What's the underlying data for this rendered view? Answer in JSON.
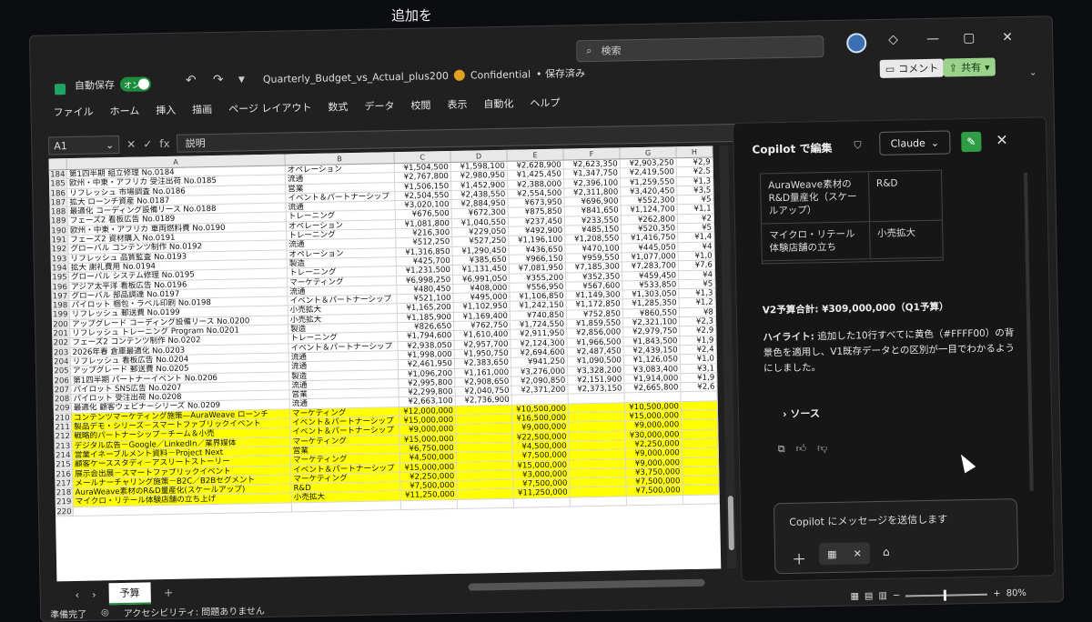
{
  "caption": "追加を",
  "app": {
    "autosave_label": "自動保存",
    "toggle": "オン",
    "filename": "Quarterly_Budget_vs_Actual_plus200",
    "sensitivity": "Confidential",
    "saved": "• 保存済み",
    "search_placeholder": "検索",
    "comment_btn": "コメント",
    "share_btn": "共有"
  },
  "ribbon": [
    "ファイル",
    "ホーム",
    "挿入",
    "描画",
    "ページ レイアウト",
    "数式",
    "データ",
    "校閲",
    "表示",
    "自動化",
    "ヘルプ"
  ],
  "formula": {
    "namebox": "A1",
    "value": "説明"
  },
  "columns": [
    "A",
    "B",
    "C",
    "D",
    "E",
    "F",
    "G",
    "H"
  ],
  "rows": [
    {
      "n": "184",
      "a": "第1四半期 組立修理 No.0184",
      "b": "オペレーション",
      "c": "¥1,504,500",
      "d": "¥1,598,100",
      "e": "¥2,628,900",
      "f": "¥2,623,350",
      "g": "¥2,903,250",
      "h": "¥2,9",
      "hl": false
    },
    {
      "n": "185",
      "a": "欧州・中東・アフリカ 受注出荷 No.0185",
      "b": "流通",
      "c": "¥2,767,800",
      "d": "¥2,980,950",
      "e": "¥1,425,450",
      "f": "¥1,347,750",
      "g": "¥2,419,500",
      "h": "¥2,5",
      "hl": false
    },
    {
      "n": "186",
      "a": "リフレッシュ 市場調査 No.0186",
      "b": "営業",
      "c": "¥1,506,150",
      "d": "¥1,452,900",
      "e": "¥2,388,000",
      "f": "¥2,396,100",
      "g": "¥1,259,550",
      "h": "¥1,3",
      "hl": false
    },
    {
      "n": "187",
      "a": "拡大 ローンチ資産 No.0187",
      "b": "イベント＆パートナーシップ",
      "c": "¥2,504,550",
      "d": "¥2,438,550",
      "e": "¥2,554,500",
      "f": "¥2,311,800",
      "g": "¥3,420,450",
      "h": "¥3,5",
      "hl": false
    },
    {
      "n": "188",
      "a": "最適化 コーディング設備リース No.0188",
      "b": "流通",
      "c": "¥3,020,100",
      "d": "¥2,884,950",
      "e": "¥673,950",
      "f": "¥696,900",
      "g": "¥552,300",
      "h": "¥5",
      "hl": false
    },
    {
      "n": "189",
      "a": "フェーズ2 看板広告 No.0189",
      "b": "トレーニング",
      "c": "¥676,500",
      "d": "¥672,300",
      "e": "¥875,850",
      "f": "¥841,650",
      "g": "¥1,124,700",
      "h": "¥1,1",
      "hl": false
    },
    {
      "n": "190",
      "a": "欧州・中東・アフリカ 車両燃料費 No.0190",
      "b": "オペレーション",
      "c": "¥1,081,800",
      "d": "¥1,040,550",
      "e": "¥237,450",
      "f": "¥233,550",
      "g": "¥262,800",
      "h": "¥2",
      "hl": false
    },
    {
      "n": "191",
      "a": "フェーズ2 資材購入 No.0191",
      "b": "トレーニング",
      "c": "¥216,300",
      "d": "¥229,050",
      "e": "¥492,900",
      "f": "¥485,150",
      "g": "¥520,350",
      "h": "¥5",
      "hl": false
    },
    {
      "n": "192",
      "a": "グローバル コンテンツ制作 No.0192",
      "b": "流通",
      "c": "¥512,250",
      "d": "¥527,250",
      "e": "¥1,196,100",
      "f": "¥1,208,550",
      "g": "¥1,416,750",
      "h": "¥1,4",
      "hl": false
    },
    {
      "n": "193",
      "a": "リフレッシュ 品質監査 No.0193",
      "b": "オペレーション",
      "c": "¥1,316,850",
      "d": "¥1,290,450",
      "e": "¥436,650",
      "f": "¥470,100",
      "g": "¥445,050",
      "h": "¥4",
      "hl": false
    },
    {
      "n": "194",
      "a": "拡大 謝礼費用 No.0194",
      "b": "製造",
      "c": "¥425,700",
      "d": "¥385,650",
      "e": "¥966,150",
      "f": "¥959,550",
      "g": "¥1,077,000",
      "h": "¥1,0",
      "hl": false
    },
    {
      "n": "195",
      "a": "グローバル システム修理 No.0195",
      "b": "トレーニング",
      "c": "¥1,231,500",
      "d": "¥1,131,450",
      "e": "¥7,081,950",
      "f": "¥7,185,300",
      "g": "¥7,283,700",
      "h": "¥7,6",
      "hl": false
    },
    {
      "n": "196",
      "a": "アジア太平洋 看板広告 No.0196",
      "b": "マーケティング",
      "c": "¥6,998,250",
      "d": "¥6,991,050",
      "e": "¥355,200",
      "f": "¥352,350",
      "g": "¥459,450",
      "h": "¥4",
      "hl": false
    },
    {
      "n": "197",
      "a": "グローバル 部品調達 No.0197",
      "b": "流通",
      "c": "¥480,450",
      "d": "¥408,000",
      "e": "¥556,950",
      "f": "¥567,600",
      "g": "¥533,850",
      "h": "¥5",
      "hl": false
    },
    {
      "n": "198",
      "a": "パイロット 梱包・ラベル印刷 No.0198",
      "b": "イベント＆パートナーシップ",
      "c": "¥521,100",
      "d": "¥495,000",
      "e": "¥1,106,850",
      "f": "¥1,149,300",
      "g": "¥1,303,050",
      "h": "¥1,3",
      "hl": false
    },
    {
      "n": "199",
      "a": "リフレッシュ 郵送費 No.0199",
      "b": "小売拡大",
      "c": "¥1,165,200",
      "d": "¥1,102,950",
      "e": "¥1,242,150",
      "f": "¥1,172,850",
      "g": "¥1,285,350",
      "h": "¥1,2",
      "hl": false
    },
    {
      "n": "200",
      "a": "アップグレード コーディング設備リース No.0200",
      "b": "小売拡大",
      "c": "¥1,185,900",
      "d": "¥1,169,400",
      "e": "¥740,850",
      "f": "¥752,850",
      "g": "¥860,550",
      "h": "¥8",
      "hl": false
    },
    {
      "n": "201",
      "a": "リフレッシュ トレーニング Program No.0201",
      "b": "製造",
      "c": "¥826,650",
      "d": "¥762,750",
      "e": "¥1,724,550",
      "f": "¥1,859,550",
      "g": "¥2,321,100",
      "h": "¥2,3",
      "hl": false
    },
    {
      "n": "202",
      "a": "フェーズ2 コンテンツ制作 No.0202",
      "b": "トレーニング",
      "c": "¥1,794,600",
      "d": "¥1,610,400",
      "e": "¥2,911,950",
      "f": "¥2,856,000",
      "g": "¥2,979,750",
      "h": "¥2,9",
      "hl": false
    },
    {
      "n": "203",
      "a": "2026年春 倉庫最適化 No.0203",
      "b": "イベント＆パートナーシップ",
      "c": "¥2,938,050",
      "d": "¥2,957,700",
      "e": "¥2,124,300",
      "f": "¥1,966,500",
      "g": "¥1,843,500",
      "h": "¥1,9",
      "hl": false
    },
    {
      "n": "204",
      "a": "リフレッシュ 看板広告 No.0204",
      "b": "流通",
      "c": "¥1,998,000",
      "d": "¥1,950,750",
      "e": "¥2,694,600",
      "f": "¥2,487,450",
      "g": "¥2,439,150",
      "h": "¥2,4",
      "hl": false
    },
    {
      "n": "205",
      "a": "アップグレード 郵送費 No.0205",
      "b": "流通",
      "c": "¥2,461,950",
      "d": "¥2,383,650",
      "e": "¥941,250",
      "f": "¥1,090,500",
      "g": "¥1,126,050",
      "h": "¥1,0",
      "hl": false
    },
    {
      "n": "206",
      "a": "第1四半期 パートナーイベント No.0206",
      "b": "製造",
      "c": "¥1,096,200",
      "d": "¥1,161,000",
      "e": "¥3,276,000",
      "f": "¥3,328,200",
      "g": "¥3,083,400",
      "h": "¥3,1",
      "hl": false
    },
    {
      "n": "207",
      "a": "パイロット SNS広告 No.0207",
      "b": "流通",
      "c": "¥2,995,800",
      "d": "¥2,908,650",
      "e": "¥2,090,850",
      "f": "¥2,151,900",
      "g": "¥1,914,000",
      "h": "¥1,9",
      "hl": false
    },
    {
      "n": "208",
      "a": "パイロット 受注出荷 No.0208",
      "b": "営業",
      "c": "¥2,299,800",
      "d": "¥2,040,750",
      "e": "¥2,371,200",
      "f": "¥2,373,150",
      "g": "¥2,665,800",
      "h": "¥2,6",
      "hl": false
    },
    {
      "n": "209",
      "a": "最適化 顧客ウェビナーシリーズ No.0209",
      "b": "流通",
      "c": "¥2,663,100",
      "d": "¥2,736,900",
      "e": "",
      "f": "",
      "g": "",
      "h": "",
      "hl": false
    },
    {
      "n": "210",
      "a": "コンテンツマーケティング施策—AuraWeave ローンチ",
      "b": "マーケティング",
      "c": "¥12,000,000",
      "d": "",
      "e": "¥10,500,000",
      "f": "",
      "g": "¥10,500,000",
      "h": "",
      "hl": true
    },
    {
      "n": "211",
      "a": "製品デモ・シリーズ－スマートファブリックイベント",
      "b": "イベント＆パートナーシップ",
      "c": "¥15,000,000",
      "d": "",
      "e": "¥16,500,000",
      "f": "",
      "g": "¥15,000,000",
      "h": "",
      "hl": true
    },
    {
      "n": "212",
      "a": "戦略的パートナーシップ－チーム＆小売",
      "b": "イベント＆パートナーシップ",
      "c": "¥9,000,000",
      "d": "",
      "e": "¥9,000,000",
      "f": "",
      "g": "¥9,000,000",
      "h": "",
      "hl": true
    },
    {
      "n": "213",
      "a": "デジタル広告－Google／LinkedIn／業界媒体",
      "b": "マーケティング",
      "c": "¥15,000,000",
      "d": "",
      "e": "¥22,500,000",
      "f": "",
      "g": "¥30,000,000",
      "h": "",
      "hl": true
    },
    {
      "n": "214",
      "a": "営業イネーブルメント資料－Project Next",
      "b": "営業",
      "c": "¥6,750,000",
      "d": "",
      "e": "¥4,500,000",
      "f": "",
      "g": "¥2,250,000",
      "h": "",
      "hl": true
    },
    {
      "n": "215",
      "a": "顧客ケーススタディ－アスリートストーリー",
      "b": "マーケティング",
      "c": "¥4,500,000",
      "d": "",
      "e": "¥7,500,000",
      "f": "",
      "g": "¥9,000,000",
      "h": "",
      "hl": true
    },
    {
      "n": "216",
      "a": "展示会出展－スマートファブリックイベント",
      "b": "イベント＆パートナーシップ",
      "c": "¥15,000,000",
      "d": "",
      "e": "¥15,000,000",
      "f": "",
      "g": "¥9,000,000",
      "h": "",
      "hl": true
    },
    {
      "n": "217",
      "a": "メールナーチャリング施策－B2C／B2Bセグメント",
      "b": "マーケティング",
      "c": "¥2,250,000",
      "d": "",
      "e": "¥3,000,000",
      "f": "",
      "g": "¥3,750,000",
      "h": "",
      "hl": true
    },
    {
      "n": "218",
      "a": "AuraWeave素材のR&D量産化(スケールアップ)",
      "b": "R&D",
      "c": "¥7,500,000",
      "d": "",
      "e": "¥7,500,000",
      "f": "",
      "g": "¥7,500,000",
      "h": "",
      "hl": true
    },
    {
      "n": "219",
      "a": "マイクロ・リテール体験店舗の立ち上げ",
      "b": "小売拡大",
      "c": "¥11,250,000",
      "d": "",
      "e": "¥11,250,000",
      "f": "",
      "g": "¥7,500,000",
      "h": "",
      "hl": true
    },
    {
      "n": "220",
      "a": "",
      "b": "",
      "c": "",
      "d": "",
      "e": "",
      "f": "",
      "g": "",
      "h": "",
      "hl": false
    }
  ],
  "sheet_tab": "予算",
  "status": {
    "ready": "準備完了",
    "accessibility": "アクセシビリティ: 問題ありません",
    "zoom": "80%"
  },
  "copilot": {
    "title": "Copilot で編集",
    "model": "Claude",
    "table": [
      {
        "a": "AuraWeave素材の R&D量産化（スケールアップ）",
        "b": "R&D"
      },
      {
        "a": "マイクロ・リテール体験店舗の立ち",
        "b": "小売拡大"
      }
    ],
    "total": "V2予算合計: ¥309,000,000（Q1予算）",
    "highlight_label": "ハイライト:",
    "highlight_text": "追加した10行すべてに黄色（#FFFF00）の背景色を適用し、V1既存データとの区別が一目でわかるようにしました。",
    "source": "ソース",
    "input_placeholder": "Copilot にメッセージを送信します"
  },
  "colors": {
    "highlight": "#ffff00",
    "accent": "#1e8e3e"
  }
}
